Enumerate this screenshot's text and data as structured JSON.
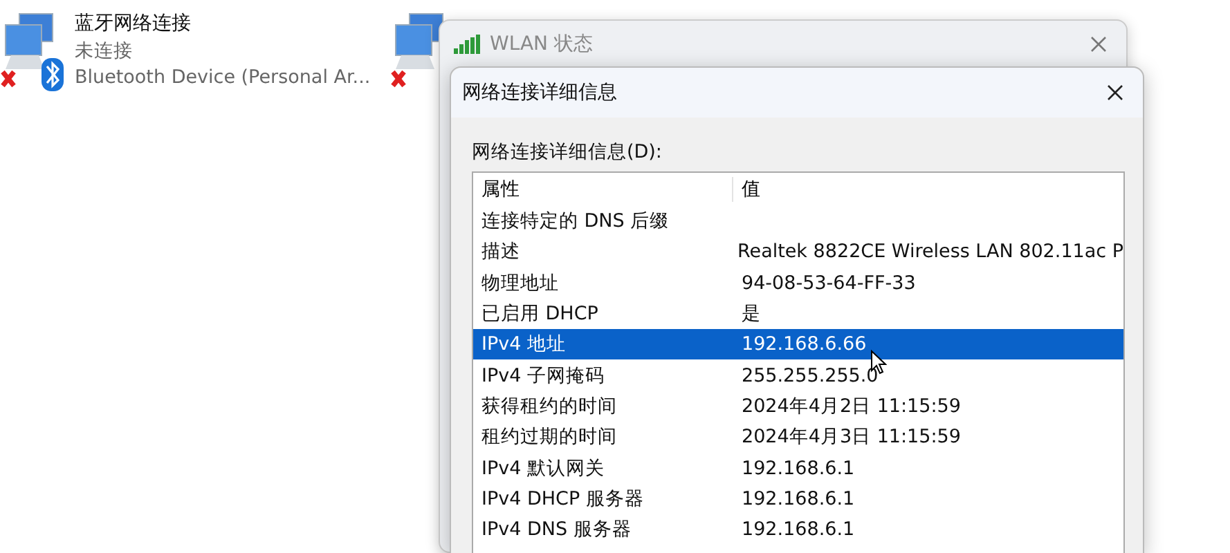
{
  "connections": [
    {
      "name": "蓝牙网络连接",
      "status": "未连接",
      "device": "Bluetooth Device (Personal Ar...",
      "kind": "bluetooth",
      "disconnected": true
    },
    {
      "kind": "wired",
      "disconnected": true
    }
  ],
  "status_window": {
    "title": "WLAN 状态"
  },
  "details_dialog": {
    "title": "网络连接详细信息",
    "list_label": "网络连接详细信息(D):",
    "columns": [
      "属性",
      "值"
    ],
    "rows": [
      {
        "property": "连接特定的 DNS 后缀",
        "value": "",
        "selected": false
      },
      {
        "property": "描述",
        "value": "Realtek 8822CE Wireless LAN 802.11ac P",
        "selected": false
      },
      {
        "property": "物理地址",
        "value": "94-08-53-64-FF-33",
        "selected": false
      },
      {
        "property": "已启用 DHCP",
        "value": "是",
        "selected": false
      },
      {
        "property": "IPv4 地址",
        "value": "192.168.6.66",
        "selected": true
      },
      {
        "property": "IPv4 子网掩码",
        "value": "255.255.255.0",
        "selected": false
      },
      {
        "property": "获得租约的时间",
        "value": "2024年4月2日 11:15:59",
        "selected": false
      },
      {
        "property": "租约过期的时间",
        "value": "2024年4月3日 11:15:59",
        "selected": false
      },
      {
        "property": "IPv4 默认网关",
        "value": "192.168.6.1",
        "selected": false
      },
      {
        "property": "IPv4 DHCP 服务器",
        "value": "192.168.6.1",
        "selected": false
      },
      {
        "property": "IPv4 DNS 服务器",
        "value": "192.168.6.1",
        "selected": false
      }
    ]
  }
}
